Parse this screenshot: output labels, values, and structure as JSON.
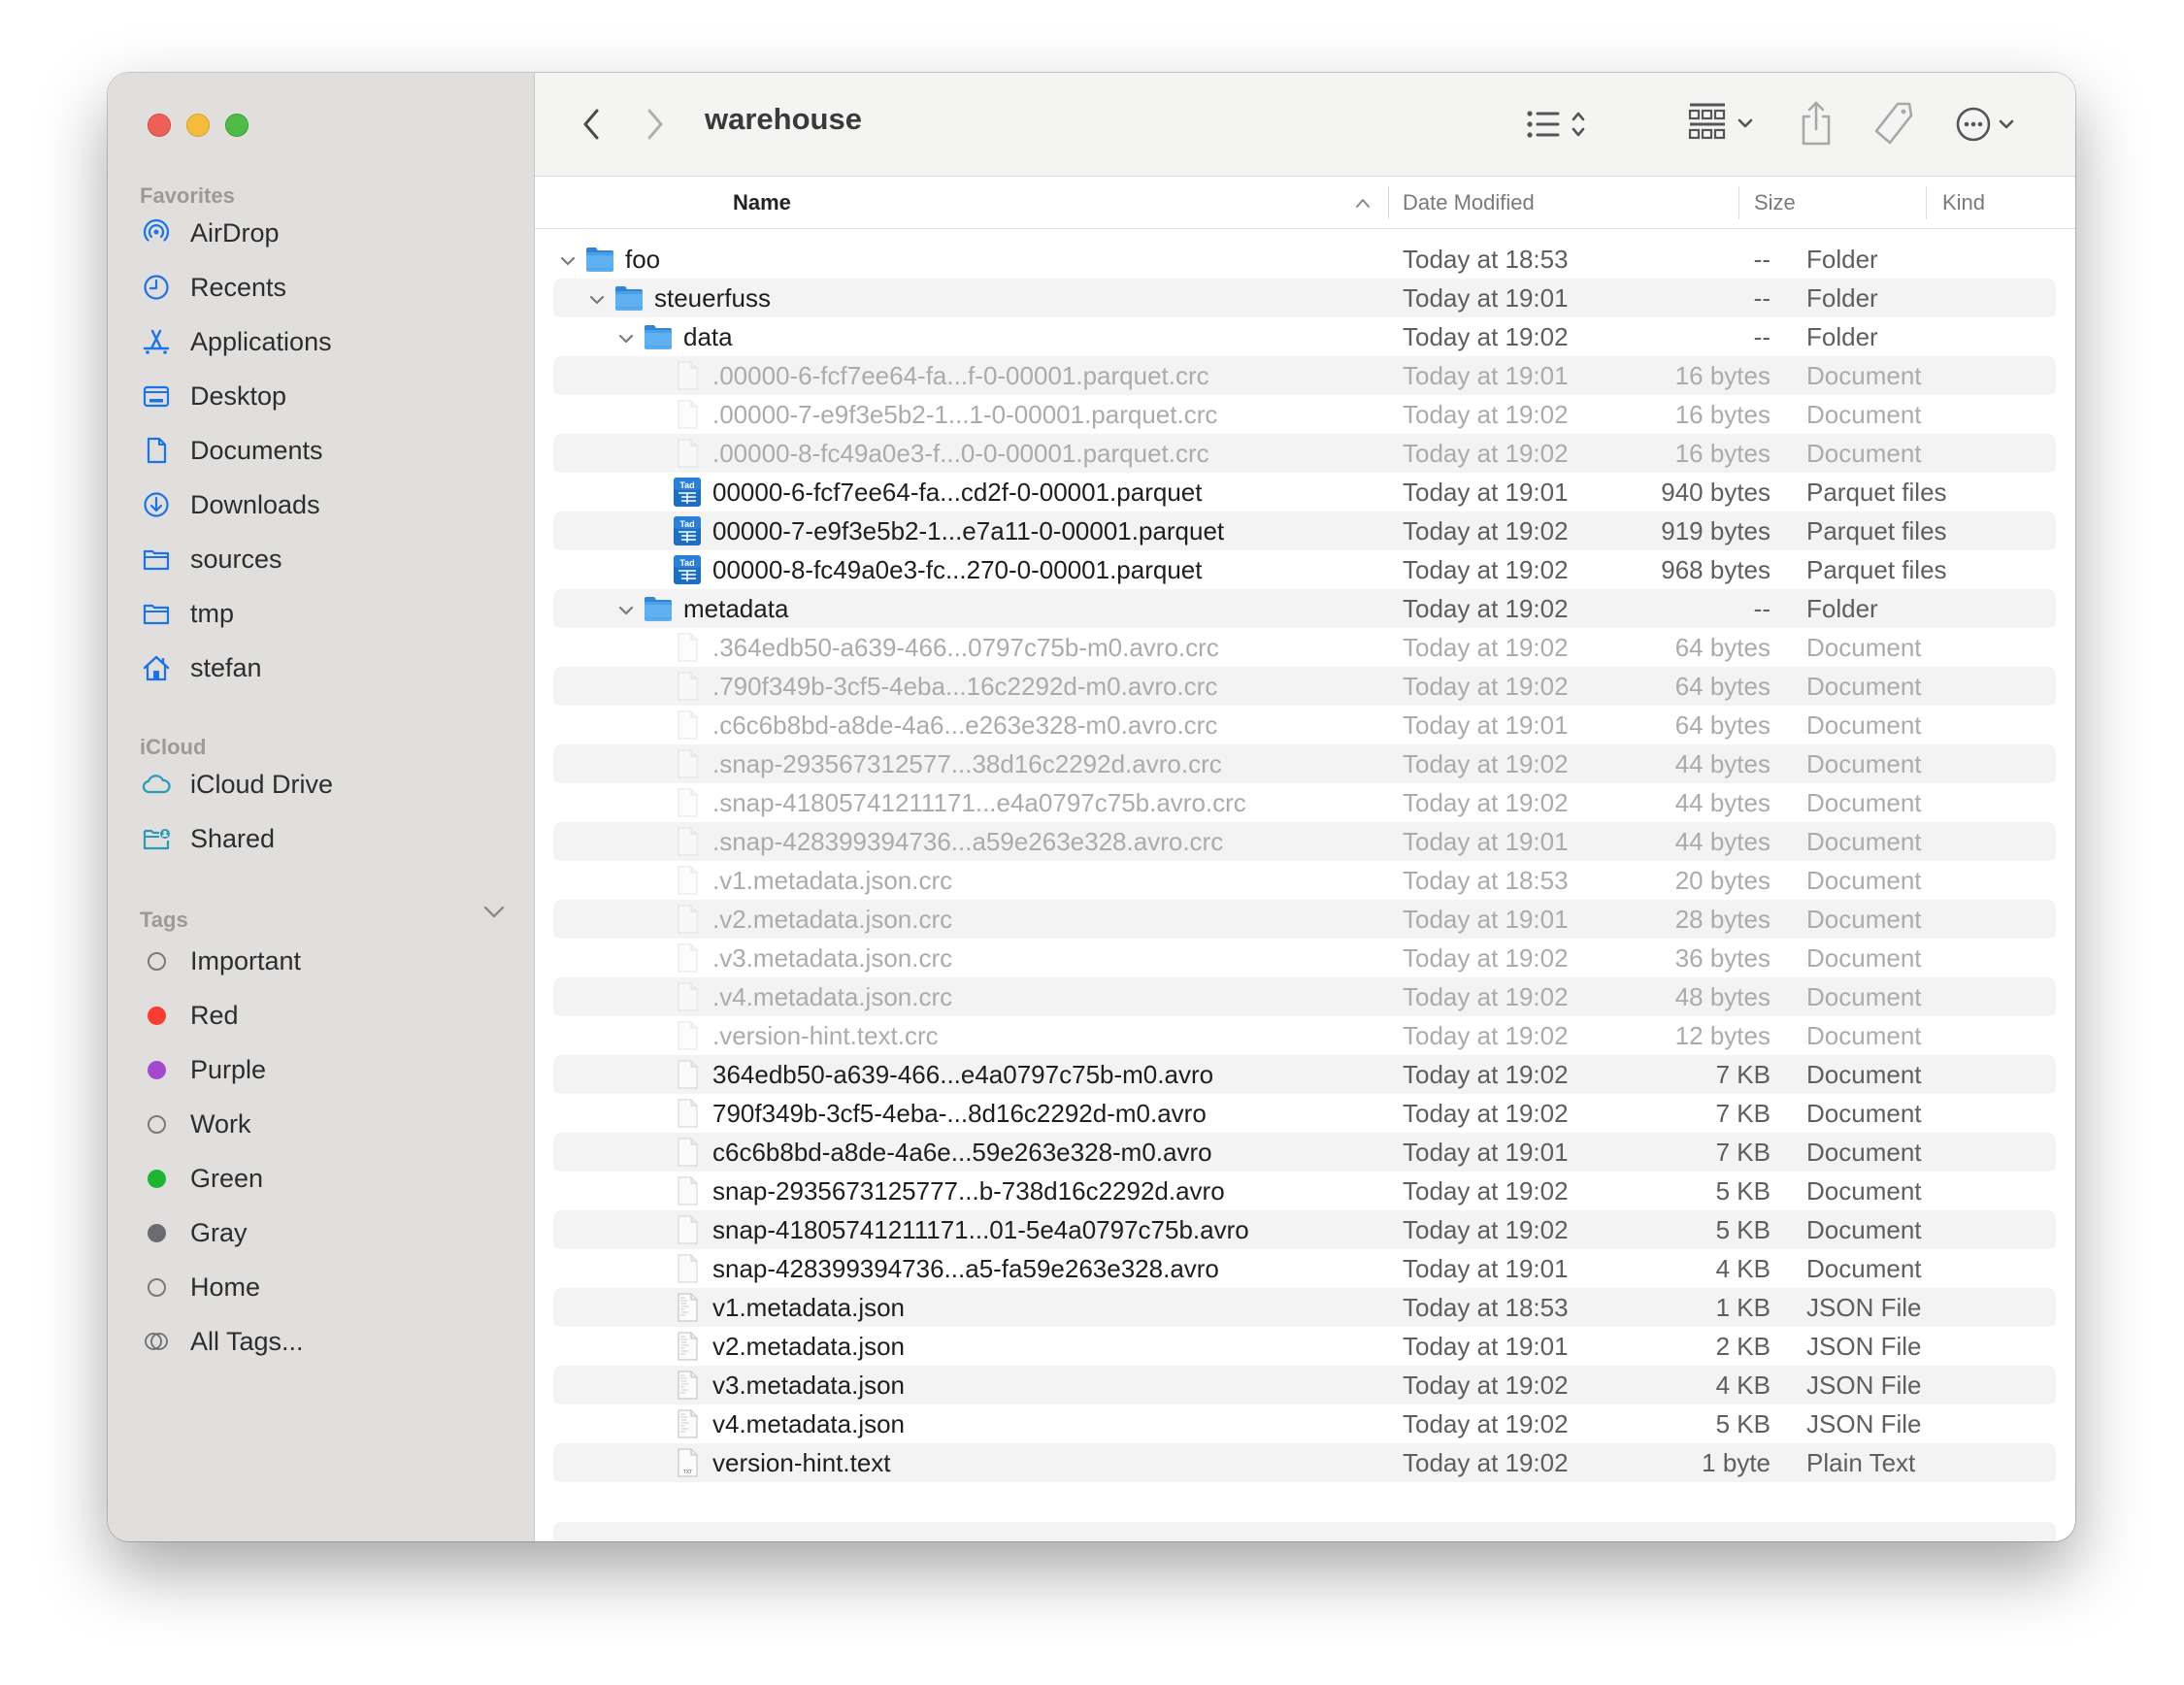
{
  "window": {
    "title": "warehouse",
    "traffic_lights": {
      "close": "#ee5f55",
      "minimize": "#f6bc3c",
      "maximize": "#4fbd45"
    }
  },
  "toolbar": {
    "back_icon": "chevron-left-icon",
    "forward_icon": "chevron-right-icon",
    "view_icon": "list-view-icon",
    "group_icon": "group-grid-icon",
    "share_icon": "share-icon",
    "tag_icon": "tag-icon",
    "more_icon": "ellipsis-circle-icon",
    "search_icon": "search-icon"
  },
  "sidebar": {
    "accent": "#1a73e8",
    "favorites_label": "Favorites",
    "favorites": [
      {
        "label": "AirDrop",
        "icon": "airdrop-icon"
      },
      {
        "label": "Recents",
        "icon": "clock-icon"
      },
      {
        "label": "Applications",
        "icon": "applications-icon"
      },
      {
        "label": "Desktop",
        "icon": "desktop-icon"
      },
      {
        "label": "Documents",
        "icon": "document-icon"
      },
      {
        "label": "Downloads",
        "icon": "download-icon"
      },
      {
        "label": "sources",
        "icon": "folder-icon"
      },
      {
        "label": "tmp",
        "icon": "folder-icon"
      },
      {
        "label": "stefan",
        "icon": "home-icon"
      }
    ],
    "icloud_label": "iCloud",
    "icloud": [
      {
        "label": "iCloud Drive",
        "icon": "cloud-icon"
      },
      {
        "label": "Shared",
        "icon": "shared-folder-icon"
      }
    ],
    "tags_label": "Tags",
    "tags": [
      {
        "label": "Important",
        "color": null
      },
      {
        "label": "Red",
        "color": "#fb3b30"
      },
      {
        "label": "Purple",
        "color": "#a449c9"
      },
      {
        "label": "Work",
        "color": null
      },
      {
        "label": "Green",
        "color": "#1cb632"
      },
      {
        "label": "Gray",
        "color": "#6c6b70"
      },
      {
        "label": "Home",
        "color": null
      },
      {
        "label": "All Tags...",
        "color": "all"
      }
    ]
  },
  "columns": {
    "name": "Name",
    "date": "Date Modified",
    "size": "Size",
    "kind": "Kind",
    "sort_indicator": "ascending"
  },
  "rows": [
    {
      "name": "foo",
      "date": "Today at 18:53",
      "size": "--",
      "kind": "Folder",
      "depth": 0,
      "type": "folder",
      "expanded": true,
      "hidden": false
    },
    {
      "name": "steuerfuss",
      "date": "Today at 19:01",
      "size": "--",
      "kind": "Folder",
      "depth": 1,
      "type": "folder",
      "expanded": true,
      "hidden": false
    },
    {
      "name": "data",
      "date": "Today at 19:02",
      "size": "--",
      "kind": "Folder",
      "depth": 2,
      "type": "folder",
      "expanded": true,
      "hidden": false
    },
    {
      "name": ".00000-6-fcf7ee64-fa...f-0-00001.parquet.crc",
      "date": "Today at 19:01",
      "size": "16 bytes",
      "kind": "Document",
      "depth": 3,
      "type": "doc",
      "hidden": true
    },
    {
      "name": ".00000-7-e9f3e5b2-1...1-0-00001.parquet.crc",
      "date": "Today at 19:02",
      "size": "16 bytes",
      "kind": "Document",
      "depth": 3,
      "type": "doc",
      "hidden": true
    },
    {
      "name": ".00000-8-fc49a0e3-f...0-0-00001.parquet.crc",
      "date": "Today at 19:02",
      "size": "16 bytes",
      "kind": "Document",
      "depth": 3,
      "type": "doc",
      "hidden": true
    },
    {
      "name": "00000-6-fcf7ee64-fa...cd2f-0-00001.parquet",
      "date": "Today at 19:01",
      "size": "940 bytes",
      "kind": "Parquet files",
      "depth": 3,
      "type": "parquet",
      "hidden": false
    },
    {
      "name": "00000-7-e9f3e5b2-1...e7a11-0-00001.parquet",
      "date": "Today at 19:02",
      "size": "919 bytes",
      "kind": "Parquet files",
      "depth": 3,
      "type": "parquet",
      "hidden": false
    },
    {
      "name": "00000-8-fc49a0e3-fc...270-0-00001.parquet",
      "date": "Today at 19:02",
      "size": "968 bytes",
      "kind": "Parquet files",
      "depth": 3,
      "type": "parquet",
      "hidden": false
    },
    {
      "name": "metadata",
      "date": "Today at 19:02",
      "size": "--",
      "kind": "Folder",
      "depth": 2,
      "type": "folder",
      "expanded": true,
      "hidden": false
    },
    {
      "name": ".364edb50-a639-466...0797c75b-m0.avro.crc",
      "date": "Today at 19:02",
      "size": "64 bytes",
      "kind": "Document",
      "depth": 3,
      "type": "doc",
      "hidden": true
    },
    {
      "name": ".790f349b-3cf5-4eba...16c2292d-m0.avro.crc",
      "date": "Today at 19:02",
      "size": "64 bytes",
      "kind": "Document",
      "depth": 3,
      "type": "doc",
      "hidden": true
    },
    {
      "name": ".c6c6b8bd-a8de-4a6...e263e328-m0.avro.crc",
      "date": "Today at 19:01",
      "size": "64 bytes",
      "kind": "Document",
      "depth": 3,
      "type": "doc",
      "hidden": true
    },
    {
      "name": ".snap-293567312577...38d16c2292d.avro.crc",
      "date": "Today at 19:02",
      "size": "44 bytes",
      "kind": "Document",
      "depth": 3,
      "type": "doc",
      "hidden": true
    },
    {
      "name": ".snap-41805741211171...e4a0797c75b.avro.crc",
      "date": "Today at 19:02",
      "size": "44 bytes",
      "kind": "Document",
      "depth": 3,
      "type": "doc",
      "hidden": true
    },
    {
      "name": ".snap-428399394736...a59e263e328.avro.crc",
      "date": "Today at 19:01",
      "size": "44 bytes",
      "kind": "Document",
      "depth": 3,
      "type": "doc",
      "hidden": true
    },
    {
      "name": ".v1.metadata.json.crc",
      "date": "Today at 18:53",
      "size": "20 bytes",
      "kind": "Document",
      "depth": 3,
      "type": "doc",
      "hidden": true
    },
    {
      "name": ".v2.metadata.json.crc",
      "date": "Today at 19:01",
      "size": "28 bytes",
      "kind": "Document",
      "depth": 3,
      "type": "doc",
      "hidden": true
    },
    {
      "name": ".v3.metadata.json.crc",
      "date": "Today at 19:02",
      "size": "36 bytes",
      "kind": "Document",
      "depth": 3,
      "type": "doc",
      "hidden": true
    },
    {
      "name": ".v4.metadata.json.crc",
      "date": "Today at 19:02",
      "size": "48 bytes",
      "kind": "Document",
      "depth": 3,
      "type": "doc",
      "hidden": true
    },
    {
      "name": ".version-hint.text.crc",
      "date": "Today at 19:02",
      "size": "12 bytes",
      "kind": "Document",
      "depth": 3,
      "type": "doc",
      "hidden": true
    },
    {
      "name": "364edb50-a639-466...e4a0797c75b-m0.avro",
      "date": "Today at 19:02",
      "size": "7 KB",
      "kind": "Document",
      "depth": 3,
      "type": "doc",
      "hidden": false
    },
    {
      "name": "790f349b-3cf5-4eba-...8d16c2292d-m0.avro",
      "date": "Today at 19:02",
      "size": "7 KB",
      "kind": "Document",
      "depth": 3,
      "type": "doc",
      "hidden": false
    },
    {
      "name": "c6c6b8bd-a8de-4a6e...59e263e328-m0.avro",
      "date": "Today at 19:01",
      "size": "7 KB",
      "kind": "Document",
      "depth": 3,
      "type": "doc",
      "hidden": false
    },
    {
      "name": "snap-2935673125777...b-738d16c2292d.avro",
      "date": "Today at 19:02",
      "size": "5 KB",
      "kind": "Document",
      "depth": 3,
      "type": "doc",
      "hidden": false
    },
    {
      "name": "snap-41805741211171...01-5e4a0797c75b.avro",
      "date": "Today at 19:02",
      "size": "5 KB",
      "kind": "Document",
      "depth": 3,
      "type": "doc",
      "hidden": false
    },
    {
      "name": "snap-428399394736...a5-fa59e263e328.avro",
      "date": "Today at 19:01",
      "size": "4 KB",
      "kind": "Document",
      "depth": 3,
      "type": "doc",
      "hidden": false
    },
    {
      "name": "v1.metadata.json",
      "date": "Today at 18:53",
      "size": "1 KB",
      "kind": "JSON File",
      "depth": 3,
      "type": "json",
      "hidden": false
    },
    {
      "name": "v2.metadata.json",
      "date": "Today at 19:01",
      "size": "2 KB",
      "kind": "JSON File",
      "depth": 3,
      "type": "json",
      "hidden": false
    },
    {
      "name": "v3.metadata.json",
      "date": "Today at 19:02",
      "size": "4 KB",
      "kind": "JSON File",
      "depth": 3,
      "type": "json",
      "hidden": false
    },
    {
      "name": "v4.metadata.json",
      "date": "Today at 19:02",
      "size": "5 KB",
      "kind": "JSON File",
      "depth": 3,
      "type": "json",
      "hidden": false
    },
    {
      "name": "version-hint.text",
      "date": "Today at 19:02",
      "size": "1 byte",
      "kind": "Plain Text",
      "depth": 3,
      "type": "txt",
      "hidden": false
    }
  ]
}
